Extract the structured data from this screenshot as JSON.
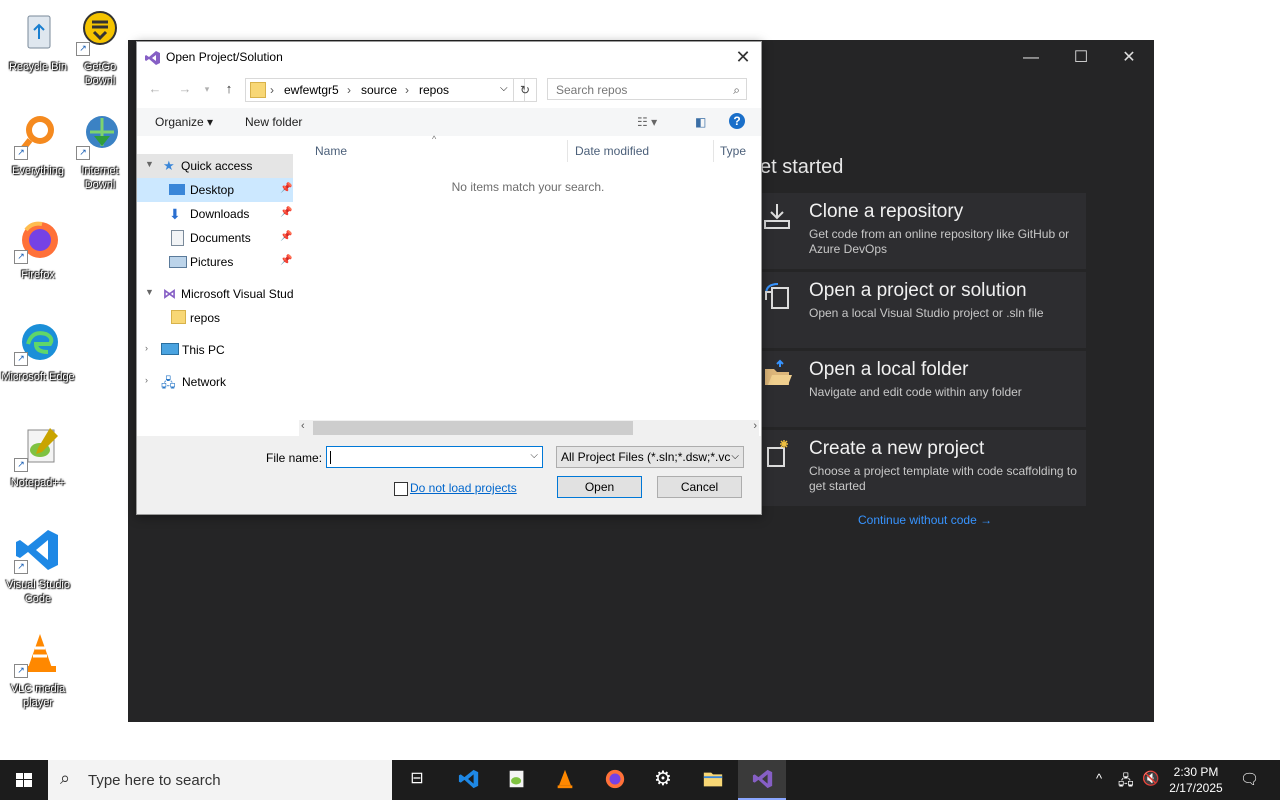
{
  "desktop": {
    "icons": [
      {
        "label": "Recycle Bin"
      },
      {
        "label": "GetGo Downl"
      },
      {
        "label": "Everything"
      },
      {
        "label": "Internet Downl"
      },
      {
        "label": "Firefox"
      },
      {
        "label": "Microsoft Edge"
      },
      {
        "label": "Notepad++"
      },
      {
        "label": "Visual Studio Code"
      },
      {
        "label": "VLC media player"
      }
    ]
  },
  "vs": {
    "get_started": "et started",
    "cards": [
      {
        "title": "Clone a repository",
        "desc": "Get code from an online repository like GitHub or Azure DevOps",
        "icon": "clone-icon"
      },
      {
        "title": "Open a project or solution",
        "desc": "Open a local Visual Studio project or .sln file",
        "icon": "open-project-icon"
      },
      {
        "title": "Open a local folder",
        "desc": "Navigate and edit code within any folder",
        "icon": "open-folder-icon"
      },
      {
        "title": "Create a new project",
        "desc": "Choose a project template with code scaffolding to get started",
        "icon": "new-project-icon"
      }
    ],
    "continue_link": "Continue without code →"
  },
  "dialog": {
    "title": "Open Project/Solution",
    "address": {
      "seg1": "ewfewtgr5",
      "seg2": "source",
      "seg3": "repos"
    },
    "search_placeholder": "Search repos",
    "toolbar": {
      "organize": "Organize ▾",
      "new_folder": "New folder"
    },
    "nav": {
      "quick_access": "Quick access",
      "desktop": "Desktop",
      "downloads": "Downloads",
      "documents": "Documents",
      "pictures": "Pictures",
      "msvs": "Microsoft Visual Stud",
      "repos": "repos",
      "this_pc": "This PC",
      "network": "Network"
    },
    "columns": {
      "name": "Name",
      "date": "Date modified",
      "type": "Type"
    },
    "empty_message": "No items match your search.",
    "file_name_label": "File name:",
    "file_name_value": "",
    "filter": "All Project Files (*.sln;*.dsw;*.vc",
    "do_not_load": "Do not load projects",
    "open_button": "Open",
    "cancel_button": "Cancel"
  },
  "taskbar": {
    "search_placeholder": "Type here to search",
    "time": "2:30 PM",
    "date": "2/17/2025"
  },
  "colors": {
    "accent": "#0078d7",
    "vs_bg": "#252526",
    "vs_card": "#2d2d30",
    "link": "#3794ff"
  }
}
